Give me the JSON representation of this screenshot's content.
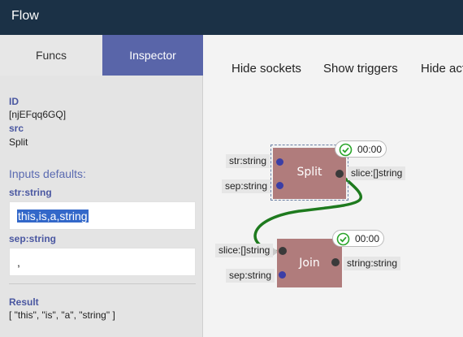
{
  "app": {
    "title": "Flow"
  },
  "tabs": [
    {
      "label": "Funcs"
    },
    {
      "label": "Inspector"
    }
  ],
  "inspector": {
    "id_label": "ID",
    "id_value": "[njEFqq6GQ]",
    "src_label": "src",
    "src_value": "Split",
    "inputs_heading": "Inputs defaults:",
    "inputs": [
      {
        "label": "str:string",
        "value": "this,is,a,string"
      },
      {
        "label": "sep:string",
        "value": ","
      }
    ],
    "result_label": "Result",
    "result_value": "[ \"this\", \"is\", \"a\", \"string\" ]"
  },
  "toolbar": {
    "hide_sockets": "Hide sockets",
    "show_triggers": "Show triggers",
    "hide_act": "Hide act"
  },
  "nodes": {
    "split": {
      "name": "Split",
      "inputs": [
        "str:string",
        "sep:string"
      ],
      "output": "slice:[]string",
      "timer": "00:00",
      "selected": true
    },
    "join": {
      "name": "Join",
      "inputs": [
        "slice:[]string",
        "sep:string"
      ],
      "output": "string:string",
      "timer": "00:00",
      "selected": false
    }
  },
  "colors": {
    "titlebar": "#1b3146",
    "accent": "#5965a9",
    "node": "#b07c7c",
    "link": "#1e7a1e",
    "input_socket": "#3b3ea6",
    "output_socket": "#3a3a3a",
    "timer_ok": "#2aa52a"
  },
  "icons": {
    "timer": "check-circle-icon"
  }
}
